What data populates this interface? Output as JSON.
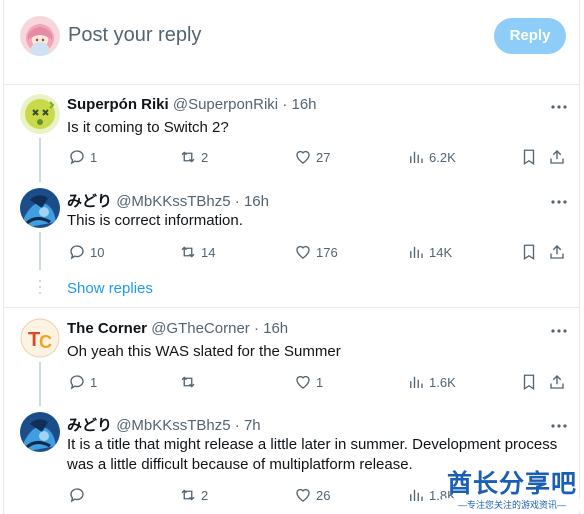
{
  "compose": {
    "placeholder": "Post your reply",
    "reply_label": "Reply"
  },
  "tweets": [
    {
      "name": "Superpón Riki",
      "handle": "@SuperponRiki",
      "time": "· 16h",
      "text": "Is it coming to Switch 2?",
      "replies": "1",
      "reposts": "2",
      "likes": "27",
      "views": "6.2K"
    },
    {
      "name": "みどり",
      "handle": "@MbKKssTBhz5",
      "time": "· 16h",
      "text": "This is correct information.",
      "replies": "10",
      "reposts": "14",
      "likes": "176",
      "views": "14K"
    },
    {
      "name": "The Corner",
      "handle": "@GTheCorner",
      "time": "· 16h",
      "text": "Oh yeah this WAS slated for the Summer",
      "replies": "1",
      "reposts": "",
      "likes": "1",
      "views": "1.6K"
    },
    {
      "name": "みどり",
      "handle": "@MbKKssTBhz5",
      "time": "· 7h",
      "text": "It is a title that might release a little later in summer. Development process was a little difficult because of multiplatform release.",
      "replies": "",
      "reposts": "2",
      "likes": "26",
      "views": "1.8K"
    }
  ],
  "show_replies": "Show replies",
  "watermark": {
    "main": "酋长分享吧",
    "sub": "—专注您关注的游戏资讯—"
  },
  "colors": {
    "accent": "#1d9bf0",
    "reply_button_disabled": "#8ecdf8",
    "secondary_text": "#536471"
  }
}
